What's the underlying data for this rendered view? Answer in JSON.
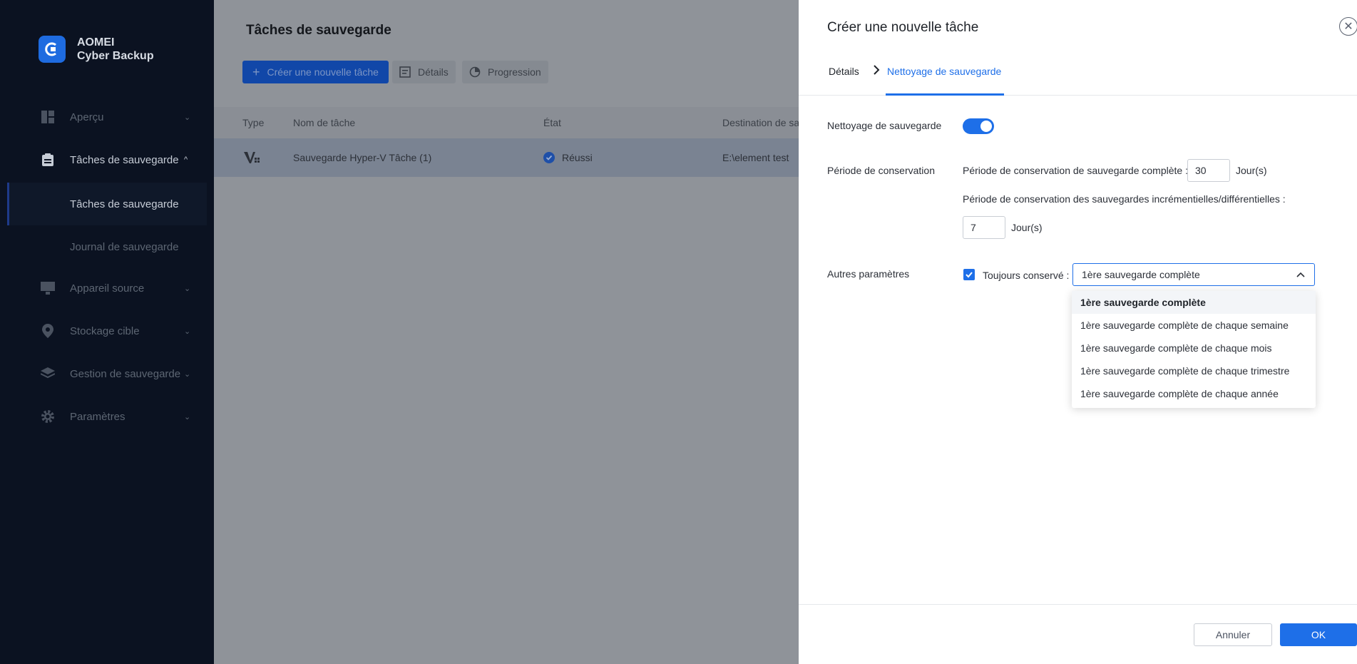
{
  "brand": {
    "line1": "AOMEI",
    "line2": "Cyber Backup"
  },
  "sidebar": {
    "items": [
      {
        "label": "Aperçu",
        "icon": "dashboard-icon"
      },
      {
        "label": "Tâches de sauvegarde",
        "icon": "clipboard-icon"
      },
      {
        "label": "Appareil source",
        "icon": "monitor-icon"
      },
      {
        "label": "Stockage cible",
        "icon": "location-pin-icon"
      },
      {
        "label": "Gestion de sauvegarde",
        "icon": "layers-icon"
      },
      {
        "label": "Paramètres",
        "icon": "gear-icon"
      }
    ],
    "sub_items": [
      {
        "label": "Tâches de sauvegarde",
        "active": true
      },
      {
        "label": "Journal de sauvegarde",
        "active": false
      }
    ]
  },
  "main": {
    "title": "Tâches de sauvegarde",
    "toolbar": {
      "create_label": "Créer une nouvelle tâche",
      "details_label": "Détails",
      "progress_label": "Progression"
    },
    "table": {
      "columns": [
        "Type",
        "Nom de tâche",
        "État",
        "Destination de sa"
      ],
      "rows": [
        {
          "name": "Sauvegarde Hyper-V Tâche (1)",
          "status": "Réussi",
          "destination": "E:\\element test"
        }
      ]
    }
  },
  "drawer": {
    "title": "Créer une nouvelle tâche",
    "steps": {
      "done": "Détails",
      "active": "Nettoyage de sauvegarde"
    },
    "cleanup_label": "Nettoyage de sauvegarde",
    "cleanup_enabled": true,
    "retention_label": "Période de conservation",
    "full_retention_label": "Période de conservation de sauvegarde complète :",
    "full_retention_value": "30",
    "incremental_retention_label": "Période de conservation des sauvegardes incrémentielles/différentielles :",
    "incremental_retention_value": "7",
    "unit_label": "Jour(s)",
    "other_label": "Autres paramètres",
    "always_keep_label": "Toujours conservé :",
    "always_keep_checked": true,
    "select_value": "1ère sauvegarde complète",
    "options": [
      "1ère sauvegarde complète",
      "1ère sauvegarde complète de chaque semaine",
      "1ère sauvegarde complète de chaque mois",
      "1ère sauvegarde complète de chaque trimestre",
      "1ère sauvegarde complète de chaque année"
    ],
    "cancel_label": "Annuler",
    "ok_label": "OK"
  },
  "colors": {
    "accent": "#1e6fe8",
    "sidebar_bg": "#0b1221",
    "overlay": "#8f9399"
  }
}
